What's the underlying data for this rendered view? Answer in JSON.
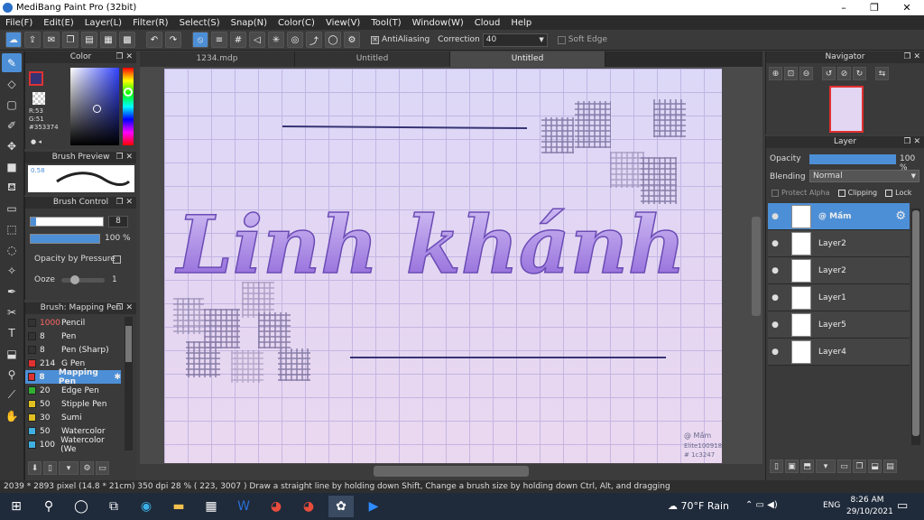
{
  "window": {
    "title": "MediBang Paint Pro (32bit)",
    "minimize": "–",
    "maximize": "❐",
    "close": "✕"
  },
  "menu": [
    "File(F)",
    "Edit(E)",
    "Layer(L)",
    "Filter(R)",
    "Select(S)",
    "Snap(N)",
    "Color(C)",
    "View(V)",
    "Tool(T)",
    "Window(W)",
    "Cloud",
    "Help"
  ],
  "toolbar": {
    "antialiasing": "AntiAliasing",
    "correction_label": "Correction",
    "correction_value": "40",
    "soft_edge": "Soft Edge"
  },
  "tabs": [
    "1234.mdp",
    "Untitled",
    "Untitled"
  ],
  "color_panel": {
    "title": "Color",
    "r": "R:53",
    "g": "G:51",
    "hex": "#353374",
    "primary": "#353374"
  },
  "brush_preview": {
    "title": "Brush Preview",
    "size": "0.58"
  },
  "brush_control": {
    "title": "Brush Control",
    "size_value": "8",
    "opacity_value": "100 %",
    "opacity_by_pressure": "Opacity by Pressure",
    "ooze_label": "Ooze",
    "ooze_value": "1"
  },
  "brush_list": {
    "title": "Brush: Mapping Pen",
    "items": [
      {
        "size": "1000",
        "name": "Pencil",
        "color": "#333333",
        "size_color": "#ff6666"
      },
      {
        "size": "8",
        "name": "Pen",
        "color": "#333333"
      },
      {
        "size": "8",
        "name": "Pen (Sharp)",
        "color": "#333333"
      },
      {
        "size": "214",
        "name": "G Pen",
        "color": "#e03030"
      },
      {
        "size": "8",
        "name": "Mapping Pen",
        "color": "#e03030",
        "selected": true
      },
      {
        "size": "20",
        "name": "Edge Pen",
        "color": "#30b030"
      },
      {
        "size": "50",
        "name": "Stipple Pen",
        "color": "#e0c020"
      },
      {
        "size": "30",
        "name": "Sumi",
        "color": "#e0c020"
      },
      {
        "size": "50",
        "name": "Watercolor",
        "color": "#40b0e0"
      },
      {
        "size": "100",
        "name": "Watercolor (We",
        "color": "#40b0e0"
      }
    ]
  },
  "canvas": {
    "artwork_text": "Linh khánh",
    "signature": "@ Mầm",
    "signature_2": "Elite100918",
    "signature_3": "# 1c3247"
  },
  "navigator": {
    "title": "Navigator"
  },
  "layer_panel": {
    "title": "Layer",
    "opacity_label": "Opacity",
    "opacity_value": "100 %",
    "blending_label": "Blending",
    "blending_value": "Normal",
    "protect_alpha": "Protect Alpha",
    "clipping": "Clipping",
    "lock": "Lock",
    "layers": [
      {
        "name": "@ Mầm",
        "selected": true
      },
      {
        "name": "Layer2"
      },
      {
        "name": "Layer2"
      },
      {
        "name": "Layer1"
      },
      {
        "name": "Layer5"
      },
      {
        "name": "Layer4"
      }
    ]
  },
  "status": {
    "text": "2039 * 2893 pixel  (14.8 * 21cm)  350 dpi  28 %  ( 223, 3007 )  Draw a straight line by holding down Shift, Change a brush size by holding down Ctrl, Alt, and dragging"
  },
  "taskbar": {
    "weather": "70°F  Rain",
    "lang": "ENG",
    "time": "8:26 AM",
    "date": "29/10/2021"
  }
}
